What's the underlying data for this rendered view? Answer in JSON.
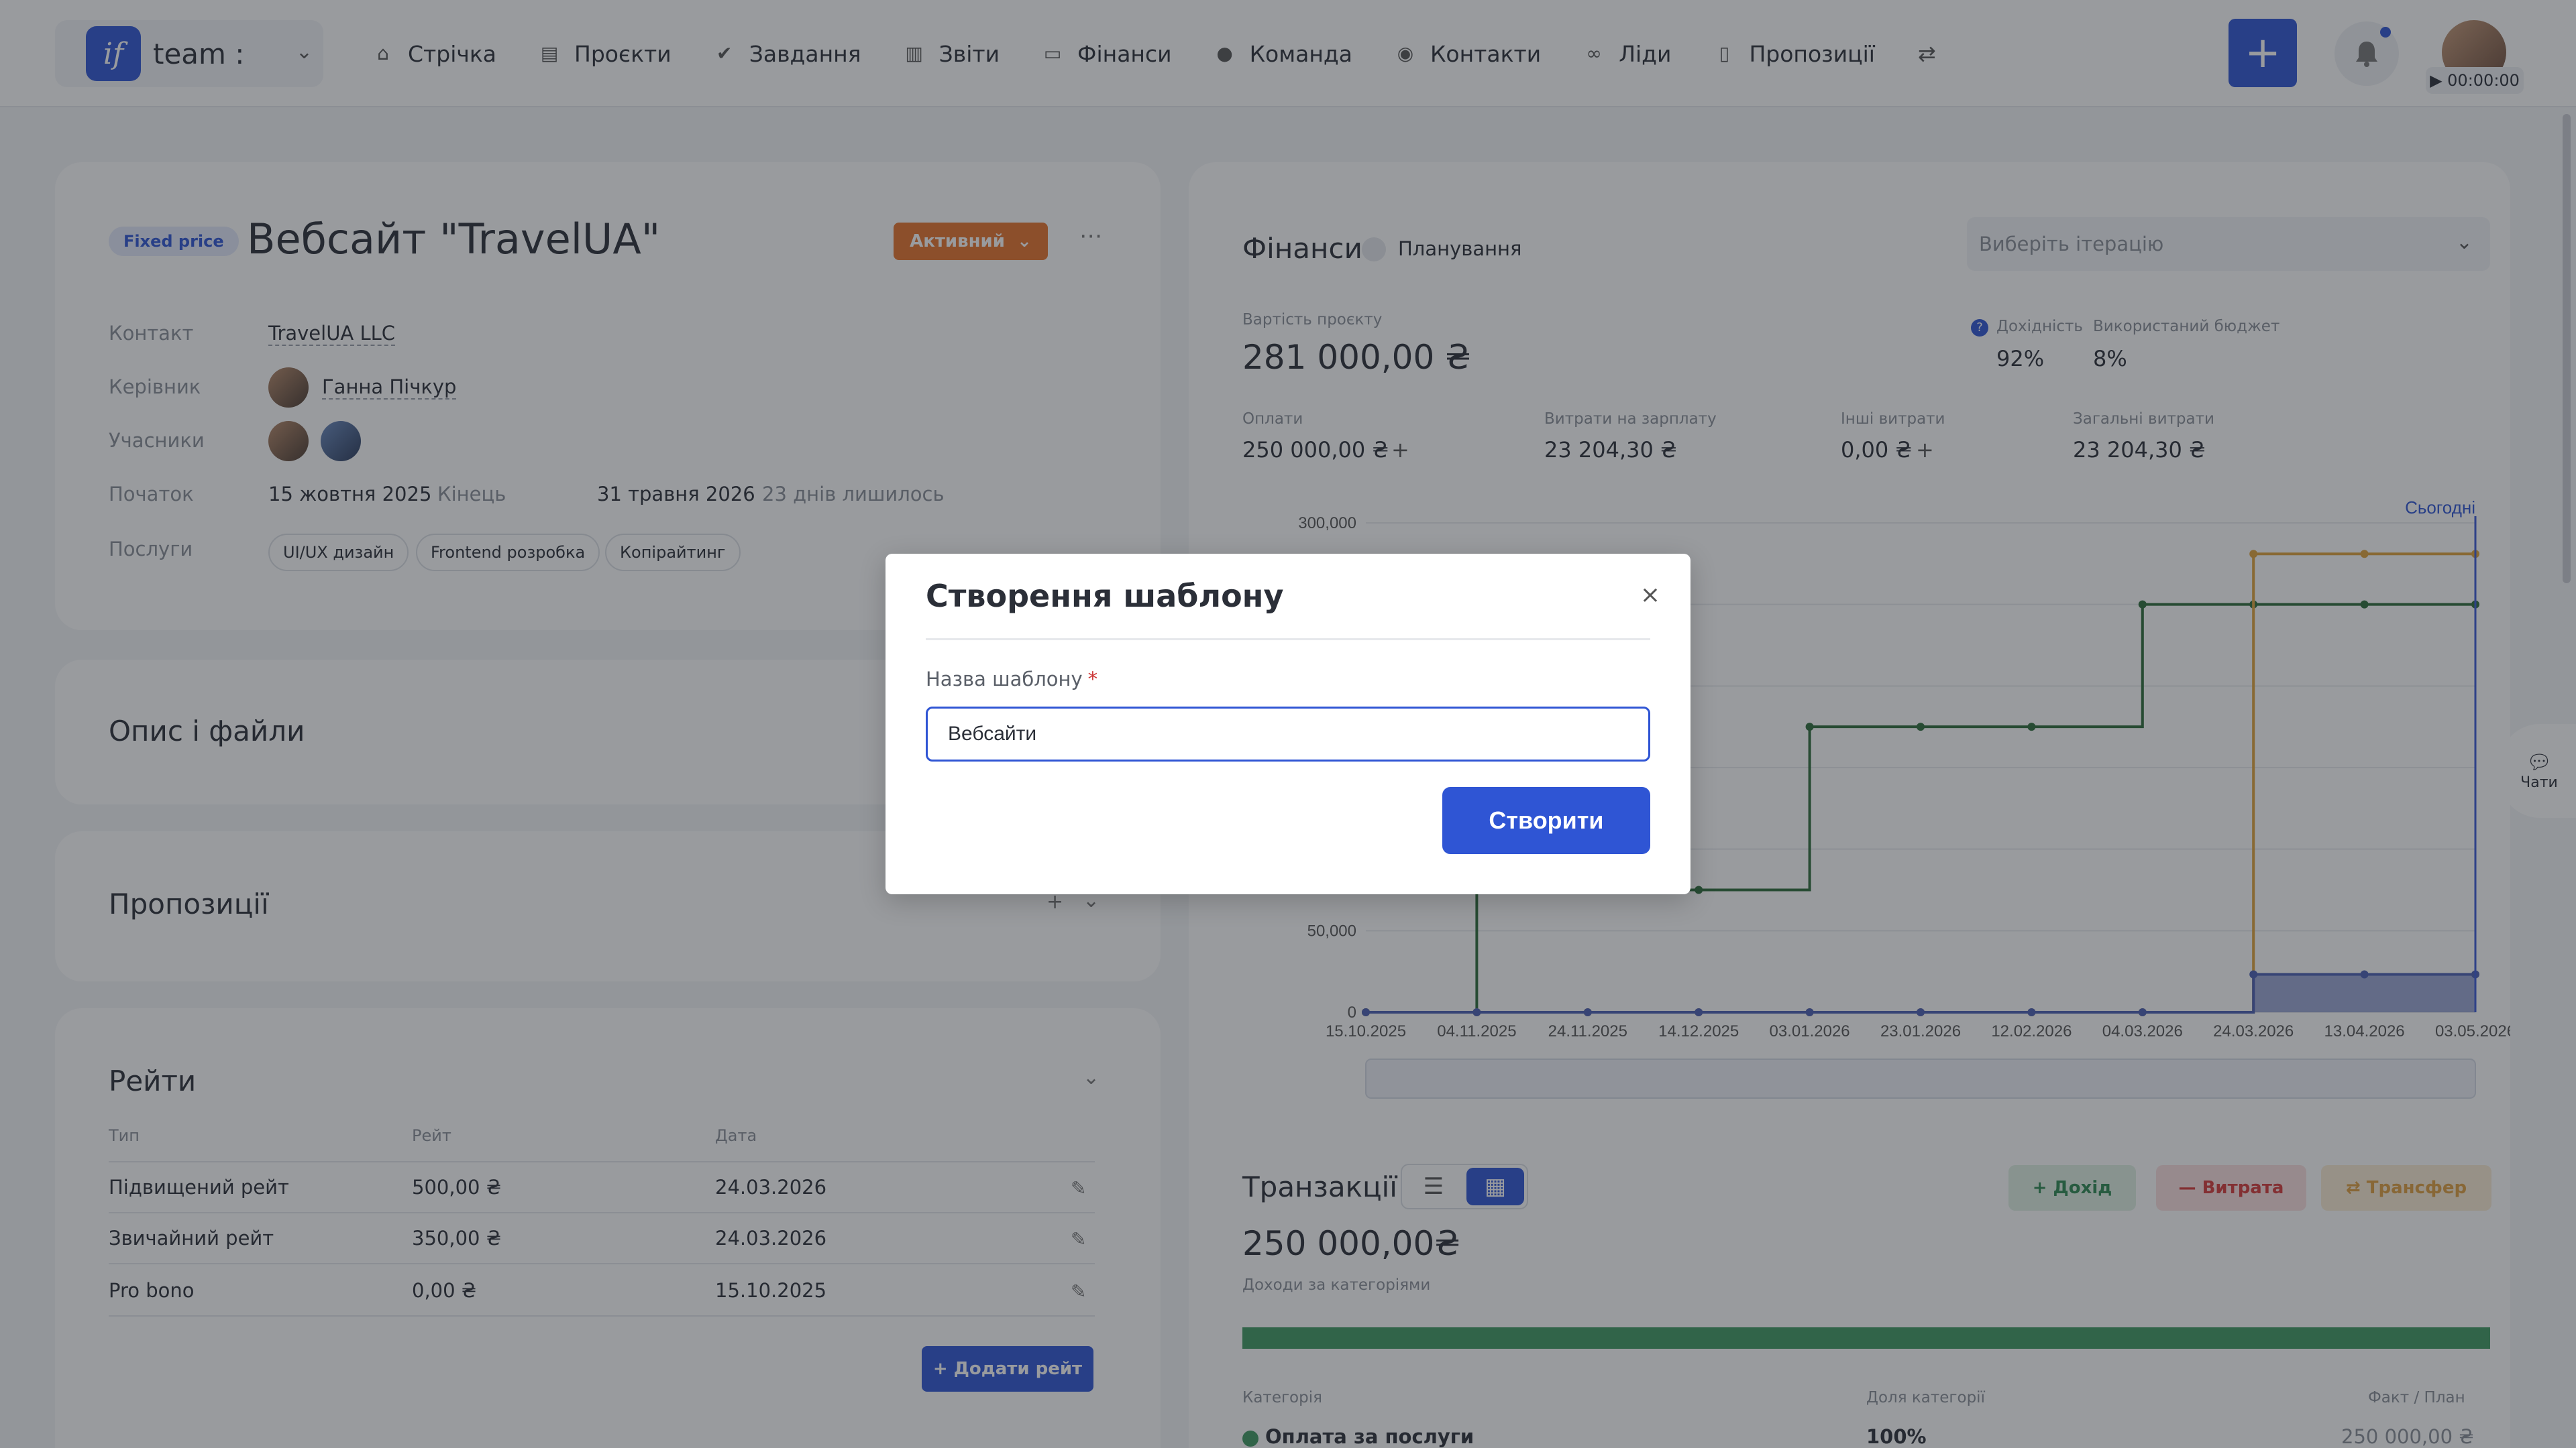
{
  "topbar": {
    "team_logo": "if",
    "team_name": "team :",
    "nav": [
      {
        "label": "Стрічка",
        "icon": "home-icon"
      },
      {
        "label": "Проєкти",
        "icon": "file-icon"
      },
      {
        "label": "Завдання",
        "icon": "check-circle-icon"
      },
      {
        "label": "Звіти",
        "icon": "report-icon"
      },
      {
        "label": "Фінанси",
        "icon": "wallet-icon"
      },
      {
        "label": "Команда",
        "icon": "user-icon"
      },
      {
        "label": "Контакти",
        "icon": "contacts-icon"
      },
      {
        "label": "Ліди",
        "icon": "link-icon"
      },
      {
        "label": "Пропозиції",
        "icon": "document-icon"
      }
    ],
    "timer": "▶ 00:00:00"
  },
  "project": {
    "badge": "Fixed price",
    "title": "Вебсайт \"TravelUA\"",
    "status": "Активний",
    "contact_label": "Контакт",
    "contact_value": "TravelUA LLC",
    "manager_label": "Керівник",
    "manager_value": "Ганна Пічкур",
    "members_label": "Учасники",
    "start_label": "Початок",
    "start_value": "15 жовтня 2025",
    "end_label": "Кінець",
    "end_value": "31 травня 2026",
    "days_left": "23 днів лишилось",
    "services_label": "Послуги",
    "services": [
      "UI/UX дизайн",
      "Frontend розробка",
      "Копірайтинг"
    ]
  },
  "sections": {
    "description": "Опис і файли",
    "proposals": "Пропозиції",
    "rates": "Рейти"
  },
  "rates": {
    "headers": [
      "Тип",
      "Рейт",
      "Дата"
    ],
    "rows": [
      {
        "type": "Підвищений рейт",
        "rate": "500,00 ₴",
        "date": "24.03.2026"
      },
      {
        "type": "Звичайний рейт",
        "rate": "350,00 ₴",
        "date": "24.03.2026"
      },
      {
        "type": "Pro bono",
        "rate": "0,00 ₴",
        "date": "15.10.2025"
      }
    ],
    "add_label": "+ Додати рейт"
  },
  "finance": {
    "title": "Фінанси",
    "planning_label": "Планування",
    "iteration_placeholder": "Виберіть ітерацію",
    "project_cost_label": "Вартість проєкту",
    "project_cost": "281 000,00 ₴",
    "profitability_label": "Дохідність",
    "profitability": "92%",
    "budget_used_label": "Використаний бюджет",
    "budget_used": "8%",
    "payments_label": "Оплати",
    "payments": "250 000,00 ₴",
    "salary_label": "Витрати на зарплату",
    "salary": "23 204,30 ₴",
    "other_label": "Інші витрати",
    "other": "0,00 ₴",
    "total_label": "Загальні витрати",
    "total": "23 204,30 ₴",
    "today_label": "Сьогодні"
  },
  "chart_data": {
    "type": "line",
    "x": [
      "15.10.2025",
      "04.11.2025",
      "24.11.2025",
      "14.12.2025",
      "03.01.2026",
      "23.01.2026",
      "12.02.2026",
      "04.03.2026",
      "24.03.2026",
      "13.04.2026",
      "03.05.2026"
    ],
    "y_ticks": [
      "0",
      "50,000",
      "300,000"
    ],
    "ylim": [
      0,
      300000
    ],
    "series": [
      {
        "color": "#2e6b3a",
        "values": [
          0,
          75000,
          75000,
          75000,
          175000,
          175000,
          175000,
          250000,
          250000,
          250000,
          250000
        ]
      },
      {
        "color": "#e0a33b",
        "values": [
          0,
          0,
          0,
          0,
          0,
          0,
          0,
          0,
          281000,
          281000,
          281000
        ]
      },
      {
        "color": "#4a5fb3",
        "values": [
          0,
          0,
          0,
          0,
          0,
          0,
          0,
          0,
          23204,
          23204,
          23204
        ]
      }
    ],
    "grid": true
  },
  "transactions": {
    "title": "Транзакції",
    "total": "250 000,00₴",
    "by_category_label": "Доходи за категоріями",
    "income_btn": "+ Дохід",
    "expense_btn": "— Витрата",
    "transfer_btn": "⇄ Трансфер",
    "headers": [
      "Категорія",
      "Доля категорії",
      "Факт / План"
    ],
    "row": {
      "name": "Оплата за послуги",
      "share": "100%",
      "fact": "250 000,00 ₴"
    }
  },
  "chat_label": "Чати",
  "modal": {
    "title": "Створення шаблону",
    "field_label": "Назва шаблону",
    "field_required": "*",
    "field_value": "Вебсайти",
    "create_label": "Створити"
  }
}
